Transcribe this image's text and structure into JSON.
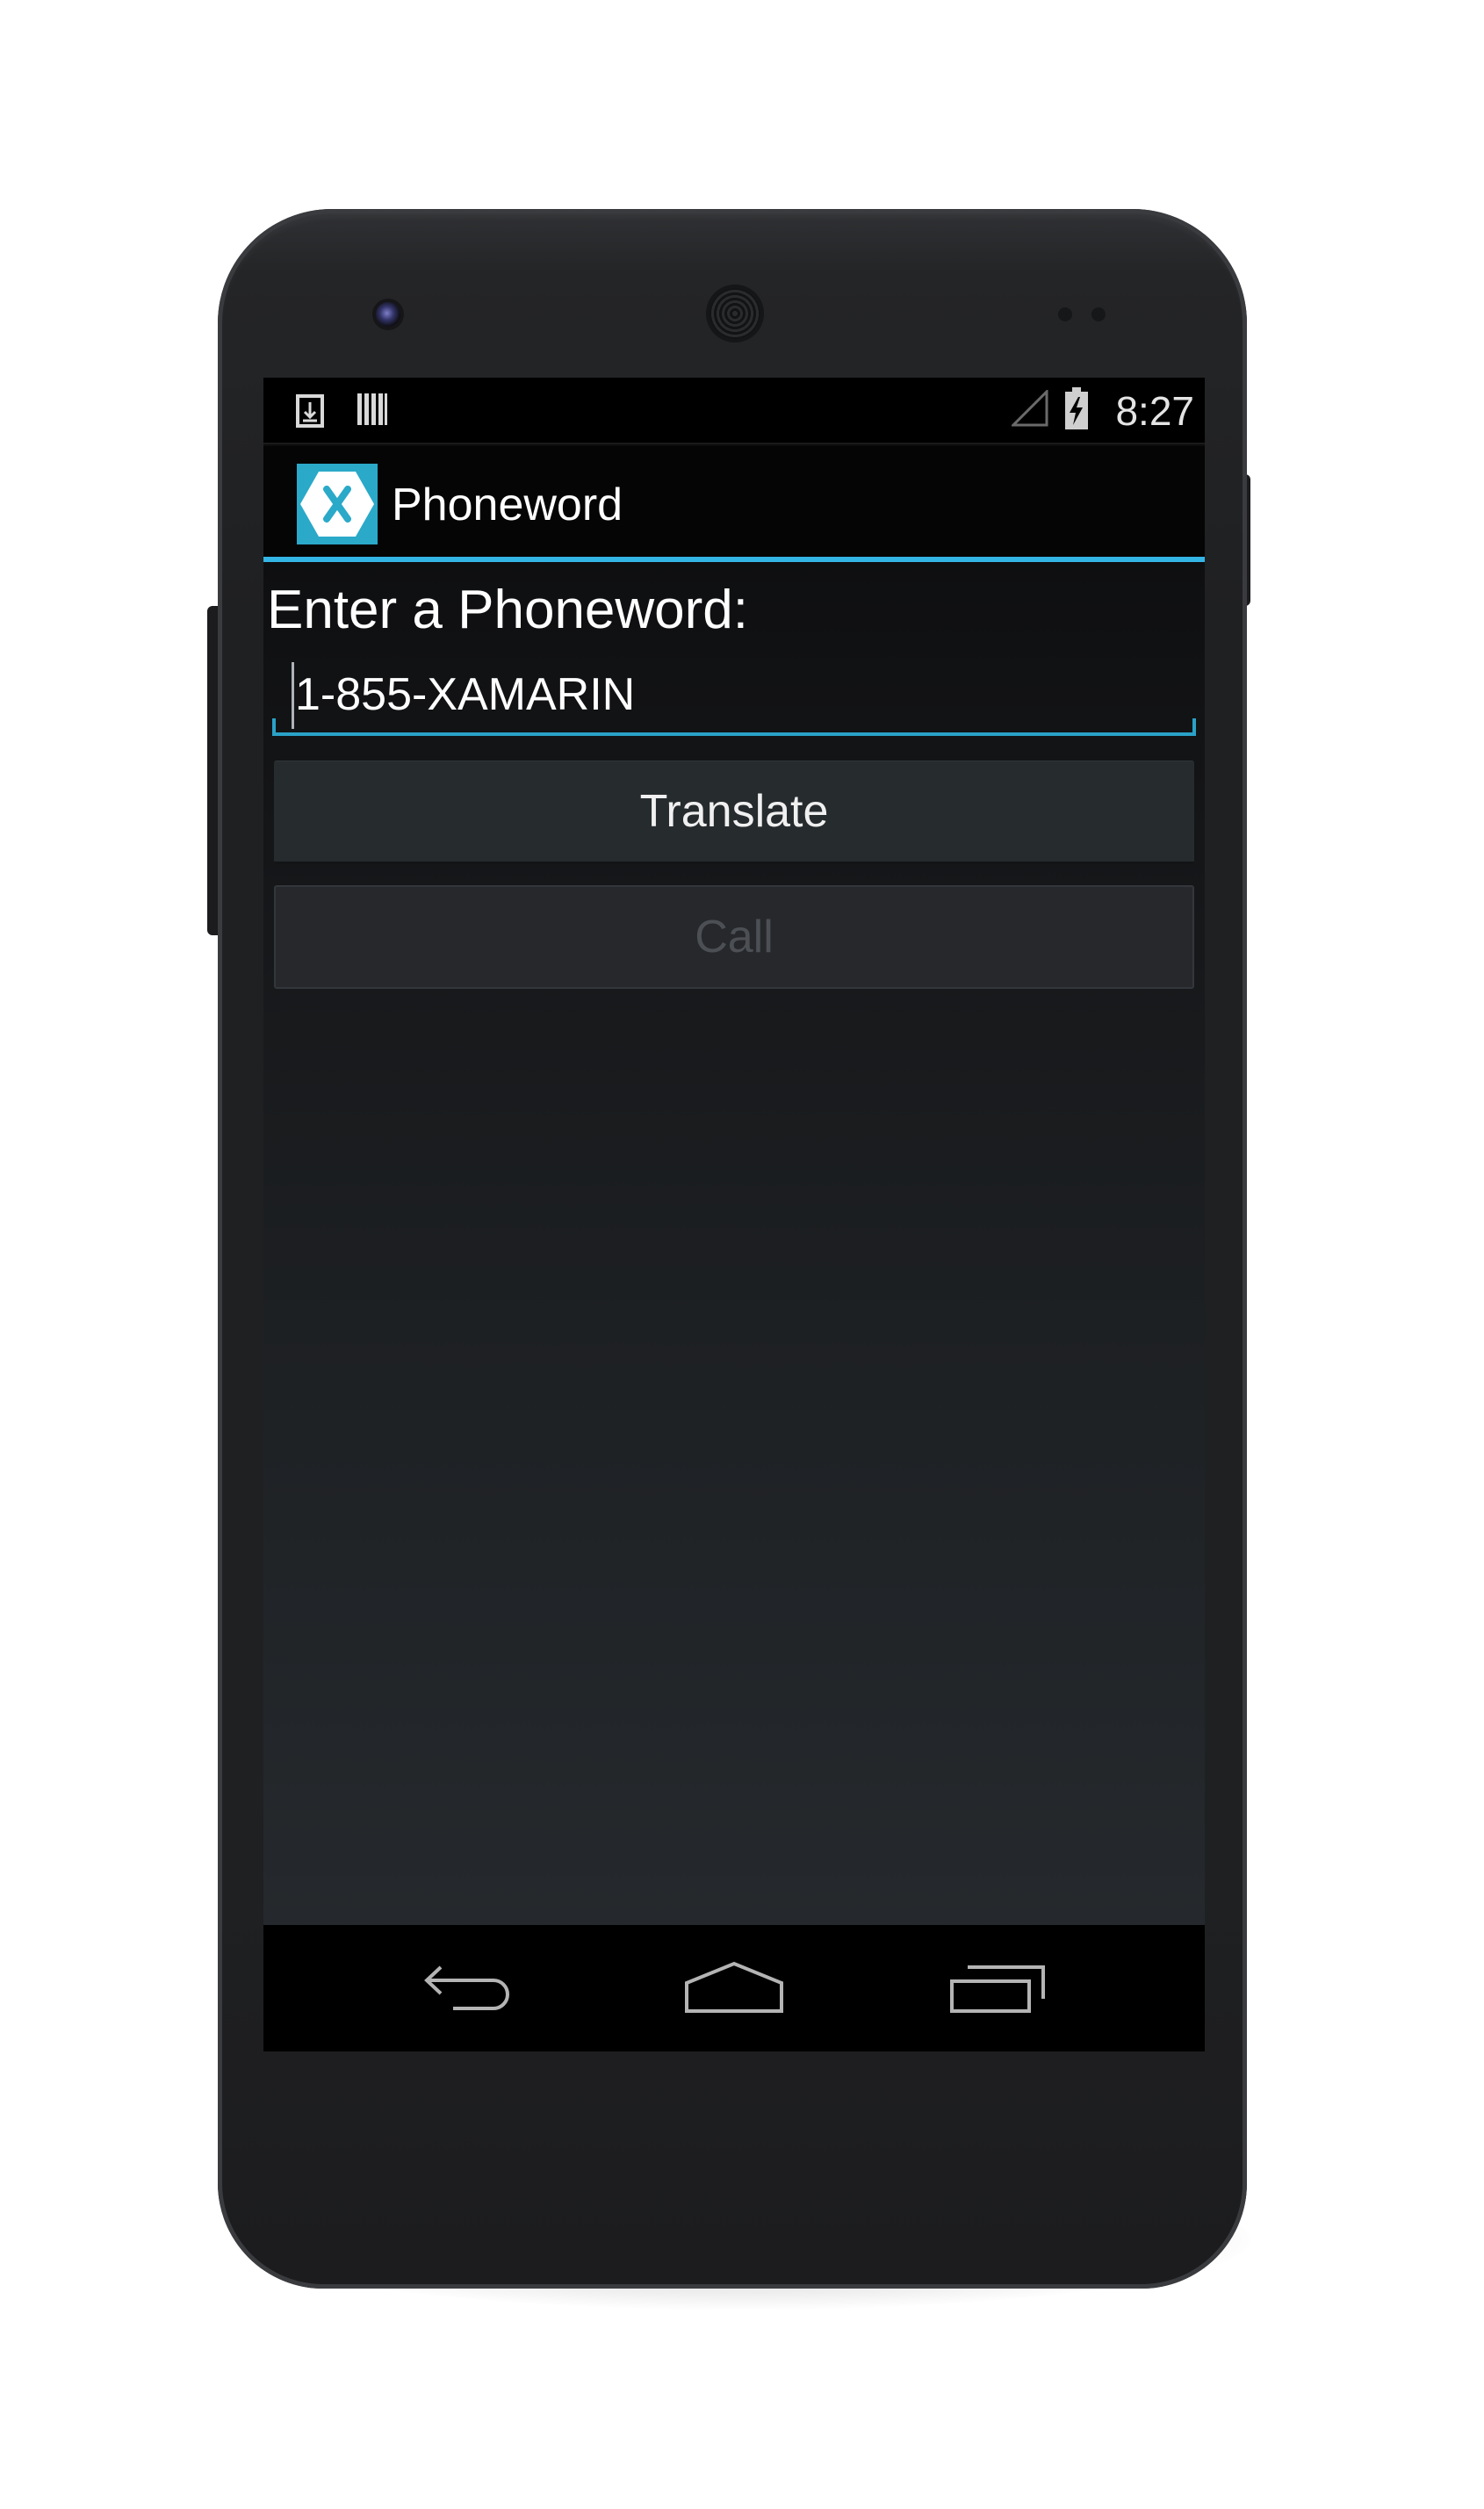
{
  "status_bar": {
    "time": "8:27",
    "icons": [
      "download-icon",
      "barcode-icon",
      "signal-icon",
      "battery-charging-icon"
    ]
  },
  "action_bar": {
    "app_icon": "xamarin-logo-icon",
    "title": "Phoneword"
  },
  "form": {
    "label": "Enter a Phoneword:",
    "phoneword_value": "1-855-XAMARIN"
  },
  "buttons": {
    "translate_label": "Translate",
    "call_label": "Call",
    "call_enabled": false
  },
  "nav_bar": {
    "icons": [
      "back-icon",
      "home-icon",
      "recent-apps-icon"
    ]
  },
  "colors": {
    "accent": "#33b5e5",
    "app_icon_bg": "#2aa9c9",
    "status_bar_bg": "#000000",
    "text_primary": "#ffffff",
    "text_disabled": "#4c5054"
  }
}
